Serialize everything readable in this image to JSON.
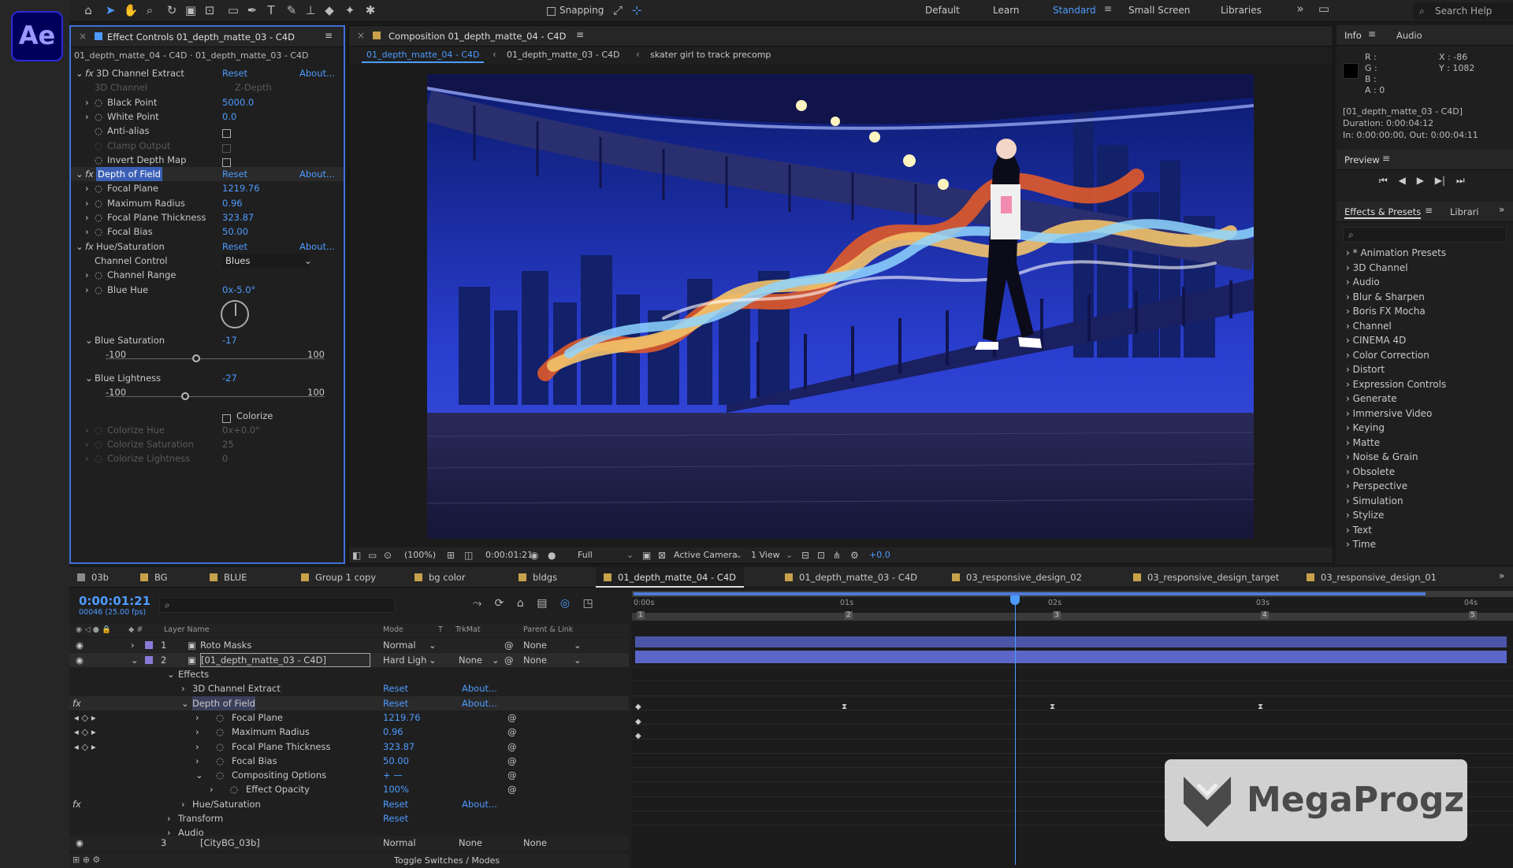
{
  "app": {
    "logo": "Ae"
  },
  "workspace": {
    "snapping_label": "Snapping",
    "tabs": [
      "Default",
      "Learn",
      "Standard",
      "Small Screen",
      "Libraries"
    ],
    "active": "Standard",
    "search_placeholder": "Search Help"
  },
  "effect_controls": {
    "tab_title": "Effect Controls 01_depth_matte_03 - C4D",
    "subtitle": "01_depth_matte_04 - C4D · 01_depth_matte_03 - C4D",
    "reset": "Reset",
    "about": "About...",
    "rows": [
      {
        "name": "3D Channel Extract",
        "kind": "effect",
        "reset": true
      },
      {
        "name": "3D Channel",
        "value": "Z-Depth",
        "kind": "dim"
      },
      {
        "name": "Black Point",
        "value": "5000.0",
        "kind": "prop"
      },
      {
        "name": "White Point",
        "value": "0.0",
        "kind": "prop"
      },
      {
        "name": "Anti-alias",
        "kind": "check"
      },
      {
        "name": "Clamp Output",
        "kind": "dimcheck"
      },
      {
        "name": "Invert Depth Map",
        "kind": "check"
      },
      {
        "name": "Depth of Field",
        "kind": "effect",
        "reset": true,
        "selected": true
      },
      {
        "name": "Focal Plane",
        "value": "1219.76",
        "kind": "prop"
      },
      {
        "name": "Maximum Radius",
        "value": "0.96",
        "kind": "prop"
      },
      {
        "name": "Focal Plane Thickness",
        "value": "323.87",
        "kind": "prop"
      },
      {
        "name": "Focal Bias",
        "value": "50.00",
        "kind": "prop"
      },
      {
        "name": "Hue/Saturation",
        "kind": "effect",
        "reset": true
      },
      {
        "name": "Channel Control",
        "value": "Blues",
        "kind": "select"
      },
      {
        "name": "Channel Range",
        "kind": "prop"
      },
      {
        "name": "Blue Hue",
        "value": "0x-5.0°",
        "kind": "prop"
      }
    ],
    "blue_saturation": {
      "label": "Blue Saturation",
      "value": "-17",
      "min": "-100",
      "max": "100",
      "level": 0.415
    },
    "blue_lightness": {
      "label": "Blue Lightness",
      "value": "-27",
      "min": "-100",
      "max": "100",
      "level": 0.365
    },
    "colorize": "Colorize",
    "colorize_rows": [
      {
        "name": "Colorize Hue",
        "value": "0x+0.0°"
      },
      {
        "name": "Colorize Saturation",
        "value": "25"
      },
      {
        "name": "Colorize Lightness",
        "value": "0"
      }
    ]
  },
  "composition": {
    "tab_title": "Composition 01_depth_matte_04 - C4D",
    "breadcrumbs": [
      "01_depth_matte_04 - C4D",
      "01_depth_matte_03 - C4D",
      "skater girl to track precomp"
    ],
    "footer": {
      "zoom": "(100%)",
      "time": "0:00:01:21",
      "resolution": "Full",
      "camera": "Active Camera",
      "views": "1 View",
      "exposure": "+0.0"
    }
  },
  "info": {
    "tab": "Info",
    "tab2": "Audio",
    "rgba": [
      "R :",
      "G :",
      "B :",
      "A : 0"
    ],
    "xy": [
      "X : -86",
      "Y : 1082"
    ],
    "name": "[01_depth_matte_03 - C4D]",
    "duration": "Duration: 0:00:04:12",
    "inout": "In: 0:00:00:00, Out: 0:00:04:11"
  },
  "preview": {
    "title": "Preview"
  },
  "effects_presets": {
    "tab": "Effects & Presets",
    "tab2": "Librari",
    "items": [
      "* Animation Presets",
      "3D Channel",
      "Audio",
      "Blur & Sharpen",
      "Boris FX Mocha",
      "Channel",
      "CINEMA 4D",
      "Color Correction",
      "Distort",
      "Expression Controls",
      "Generate",
      "Immersive Video",
      "Keying",
      "Matte",
      "Noise & Grain",
      "Obsolete",
      "Perspective",
      "Simulation",
      "Stylize",
      "Text",
      "Time"
    ]
  },
  "timeline": {
    "tabs": [
      "03b",
      "BG",
      "BLUE",
      "Group 1 copy",
      "bg color",
      "bldgs",
      "01_depth_matte_04 - C4D",
      "01_depth_matte_03 - C4D",
      "03_responsive_design_02",
      "03_responsive_design_target",
      "03_responsive_design_01"
    ],
    "active_tab": "01_depth_matte_04 - C4D",
    "tab_colors": [
      "#8a8a8a",
      "#c8a24a",
      "#c8a24a",
      "#c8a24a",
      "#c8a24a",
      "#c8a24a",
      "#c8a24a",
      "#c8a24a",
      "#c8a24a",
      "#c8a24a",
      "#c8a24a"
    ],
    "timecode": "0:00:01:21",
    "fps": "00046 (25.00 fps)",
    "col_headers": {
      "layer": "Layer Name",
      "mode": "Mode",
      "t": "T",
      "trkmat": "TrkMat",
      "parent": "Parent & Link"
    },
    "ruler": [
      "0:00s",
      "01s",
      "02s",
      "03s",
      "04s"
    ],
    "markers": [
      "1",
      "2",
      "3",
      "4",
      "5"
    ],
    "layers": [
      {
        "num": "1",
        "name": "Roto Masks",
        "mode": "Normal",
        "parent": "None"
      },
      {
        "num": "2",
        "name": "[01_depth_matte_03 - C4D]",
        "mode": "Hard Ligh",
        "trkmat": "None",
        "parent": "None"
      }
    ],
    "rows": [
      {
        "name": "Effects",
        "indent": 1
      },
      {
        "name": "3D Channel Extract",
        "indent": 2,
        "reset": "Reset",
        "about": "About..."
      },
      {
        "name": "Depth of Field",
        "indent": 2,
        "reset": "Reset",
        "about": "About...",
        "selected": true
      },
      {
        "name": "Focal Plane",
        "indent": 3,
        "value": "1219.76"
      },
      {
        "name": "Maximum Radius",
        "indent": 3,
        "value": "0.96"
      },
      {
        "name": "Focal Plane Thickness",
        "indent": 3,
        "value": "323.87"
      },
      {
        "name": "Focal Bias",
        "indent": 3,
        "value": "50.00"
      },
      {
        "name": "Compositing Options",
        "indent": 3,
        "value": "+ —"
      },
      {
        "name": "Effect Opacity",
        "indent": 4,
        "value": "100%"
      },
      {
        "name": "Hue/Saturation",
        "indent": 2,
        "reset": "Reset",
        "about": "About..."
      },
      {
        "name": "Transform",
        "indent": 1,
        "reset": "Reset"
      },
      {
        "name": "Audio",
        "indent": 1
      }
    ],
    "layer3": {
      "num": "3",
      "name": "[CityBG_03b]",
      "mode": "Normal",
      "trkmat": "None",
      "parent": "None"
    },
    "footer": "Toggle Switches / Modes"
  },
  "watermark": {
    "text": "MegaProgz"
  }
}
